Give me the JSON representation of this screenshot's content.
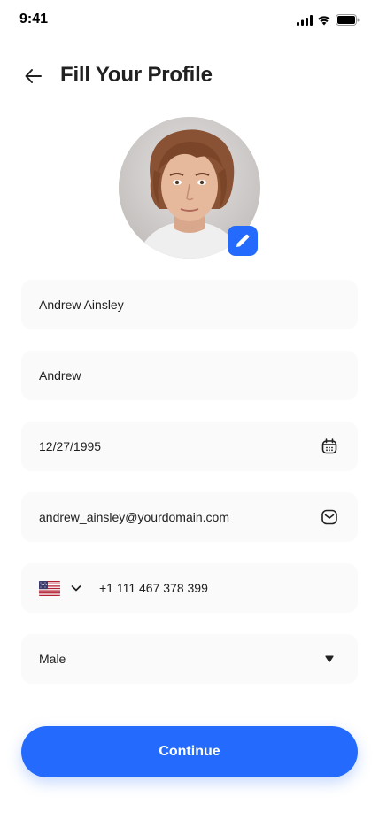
{
  "status_bar": {
    "time": "9:41"
  },
  "header": {
    "title": "Fill Your Profile"
  },
  "form": {
    "full_name": "Andrew Ainsley",
    "nickname": "Andrew",
    "date_of_birth": "12/27/1995",
    "email": "andrew_ainsley@yourdomain.com",
    "phone": "+1 111 467 378 399",
    "gender": "Male"
  },
  "actions": {
    "continue_label": "Continue"
  },
  "icons": {
    "back": "arrow-left-icon",
    "edit": "pencil-icon",
    "calendar": "calendar-icon",
    "email": "mail-icon",
    "flag": "us-flag-icon",
    "dropdown": "chevron-down-icon",
    "gender_dropdown": "triangle-down-icon"
  },
  "colors": {
    "primary": "#246bfd",
    "field_bg": "#fafafa",
    "text": "#212121"
  }
}
